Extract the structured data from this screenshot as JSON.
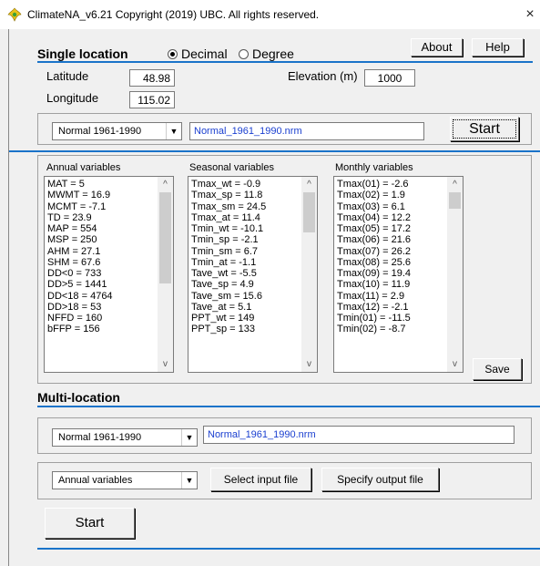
{
  "window": {
    "title": "ClimateNA_v6.21  Copyright (2019) UBC. All rights reserved.",
    "close_icon": "×"
  },
  "single": {
    "title": "Single location",
    "coord_options": [
      "Decimal",
      "Degree"
    ],
    "coord_selected": "Decimal",
    "about_label": "About",
    "help_label": "Help",
    "latitude_label": "Latitude",
    "latitude_value": "48.98",
    "longitude_label": "Longitude",
    "longitude_value": "115.02",
    "elevation_label": "Elevation (m)",
    "elevation_value": "1000",
    "normal_select": "Normal 1961-1990",
    "normal_file": "Normal_1961_1990.nrm",
    "start_label": "Start"
  },
  "lists": {
    "annual_header": "Annual variables",
    "annual": [
      "MAT = 5",
      "MWMT = 16.9",
      "MCMT = -7.1",
      "TD = 23.9",
      "MAP = 554",
      "MSP = 250",
      "AHM = 27.1",
      "SHM = 67.6",
      "DD<0 = 733",
      "DD>5 = 1441",
      "DD<18 = 4764",
      "DD>18 = 53",
      "NFFD = 160",
      "bFFP = 156"
    ],
    "seasonal_header": "Seasonal variables",
    "seasonal": [
      "Tmax_wt = -0.9",
      "Tmax_sp = 11.8",
      "Tmax_sm = 24.5",
      "Tmax_at = 11.4",
      "Tmin_wt = -10.1",
      "Tmin_sp = -2.1",
      "Tmin_sm = 6.7",
      "Tmin_at = -1.1",
      "Tave_wt = -5.5",
      "Tave_sp = 4.9",
      "Tave_sm = 15.6",
      "Tave_at = 5.1",
      "PPT_wt = 149",
      "PPT_sp = 133"
    ],
    "monthly_header": "Monthly variables",
    "monthly": [
      "Tmax(01) = -2.6",
      "Tmax(02) = 1.9",
      "Tmax(03) = 6.1",
      "Tmax(04) = 12.2",
      "Tmax(05) = 17.2",
      "Tmax(06) = 21.6",
      "Tmax(07) = 26.2",
      "Tmax(08) = 25.6",
      "Tmax(09) = 19.4",
      "Tmax(10) = 11.9",
      "Tmax(11) = 2.9",
      "Tmax(12) = -2.1",
      "Tmin(01) = -11.5",
      "Tmin(02) = -8.7"
    ],
    "save_label": "Save"
  },
  "multi": {
    "title": "Multi-location",
    "normal_select": "Normal 1961-1990",
    "normal_file": "Normal_1961_1990.nrm",
    "vars_select": "Annual variables",
    "select_input_label": "Select input file",
    "specify_output_label": "Specify output file",
    "start_label": "Start"
  }
}
